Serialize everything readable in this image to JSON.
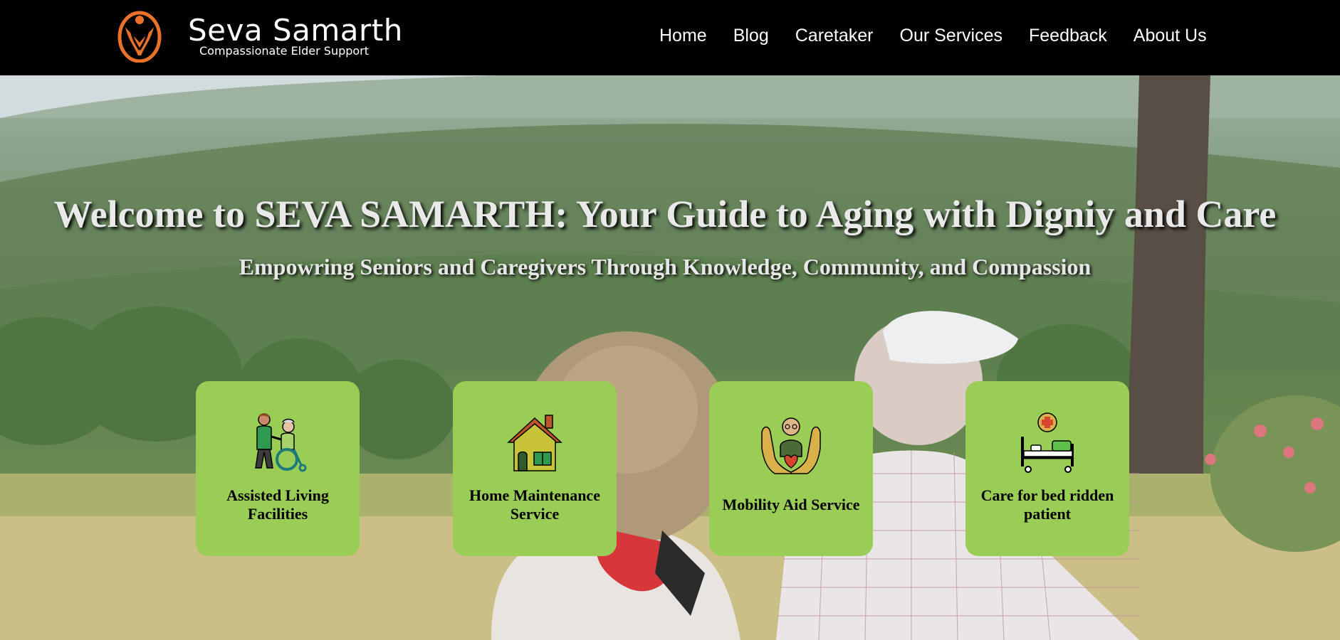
{
  "header": {
    "brand_name": "Seva Samarth",
    "tagline": "Compassionate Elder Support",
    "logo_icon": "lotus-person-icon",
    "nav": [
      {
        "label": "Home"
      },
      {
        "label": "Blog"
      },
      {
        "label": "Caretaker"
      },
      {
        "label": "Our Services"
      },
      {
        "label": "Feedback"
      },
      {
        "label": "About Us"
      }
    ]
  },
  "hero": {
    "title": "Welcome to SEVA SAMARTH: Your Guide to Aging with Digniy and Care",
    "subtitle": "Empowring Seniors and Caregivers Through Knowledge, Community, and Compassion",
    "background": "elderly-couple-landscape-photo"
  },
  "services": [
    {
      "label": "Assisted Living Facilities",
      "icon": "caregiver-wheelchair-icon"
    },
    {
      "label": "Home Maintenance Service",
      "icon": "house-icon"
    },
    {
      "label": "Mobility Aid Service",
      "icon": "elder-hands-heart-icon"
    },
    {
      "label": "Care for bed ridden patient",
      "icon": "hospital-bed-icon"
    }
  ],
  "colors": {
    "navbar_bg": "#000000",
    "card_bg": "#9acd56",
    "logo_orange": "#e8722a"
  }
}
